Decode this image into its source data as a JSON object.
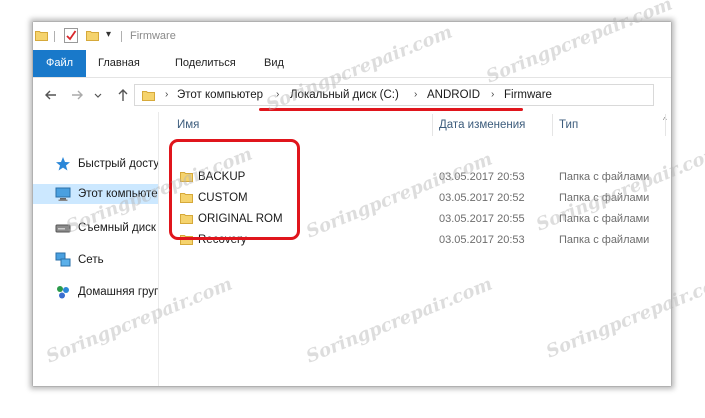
{
  "window": {
    "title": "Firmware"
  },
  "ribbon": {
    "tabs": [
      {
        "label": "Файл"
      },
      {
        "label": "Главная"
      },
      {
        "label": "Поделиться"
      },
      {
        "label": "Вид"
      }
    ]
  },
  "nav": {
    "back_icon": "back-arrow-icon",
    "forward_icon": "forward-arrow-icon",
    "recent_icon": "chevron-down-icon",
    "up_icon": "up-arrow-icon"
  },
  "address": {
    "crumbs": [
      {
        "label": "Этот компьютер"
      },
      {
        "label": "Локальный диск (C:)"
      },
      {
        "label": "ANDROID"
      },
      {
        "label": "Firmware"
      }
    ]
  },
  "sidebar": {
    "items": [
      {
        "label": "Быстрый доступ",
        "icon": "star-icon"
      },
      {
        "label": "Этот компьютер",
        "icon": "computer-icon"
      },
      {
        "label": "Съемный диск",
        "icon": "removable-drive-icon"
      },
      {
        "label": "Сеть",
        "icon": "network-icon"
      },
      {
        "label": "Домашняя группа",
        "icon": "homegroup-icon"
      }
    ]
  },
  "list": {
    "columns": {
      "name": "Имя",
      "date": "Дата изменения",
      "type": "Тип"
    },
    "rows": [
      {
        "name": "BACKUP",
        "date": "03.05.2017 20:53",
        "type": "Папка с файлами"
      },
      {
        "name": "CUSTOM",
        "date": "03.05.2017 20:52",
        "type": "Папка с файлами"
      },
      {
        "name": "ORIGINAL ROM",
        "date": "03.05.2017 20:55",
        "type": "Папка с файлами"
      },
      {
        "name": "Recovery",
        "date": "03.05.2017 20:53",
        "type": "Папка с файлами"
      }
    ]
  },
  "watermark": {
    "text": "Soringpcrepair.com"
  },
  "colors": {
    "accent": "#1979ca",
    "selection": "#cce8ff",
    "annotation": "#e0151c",
    "folder": "#f5d36d"
  }
}
